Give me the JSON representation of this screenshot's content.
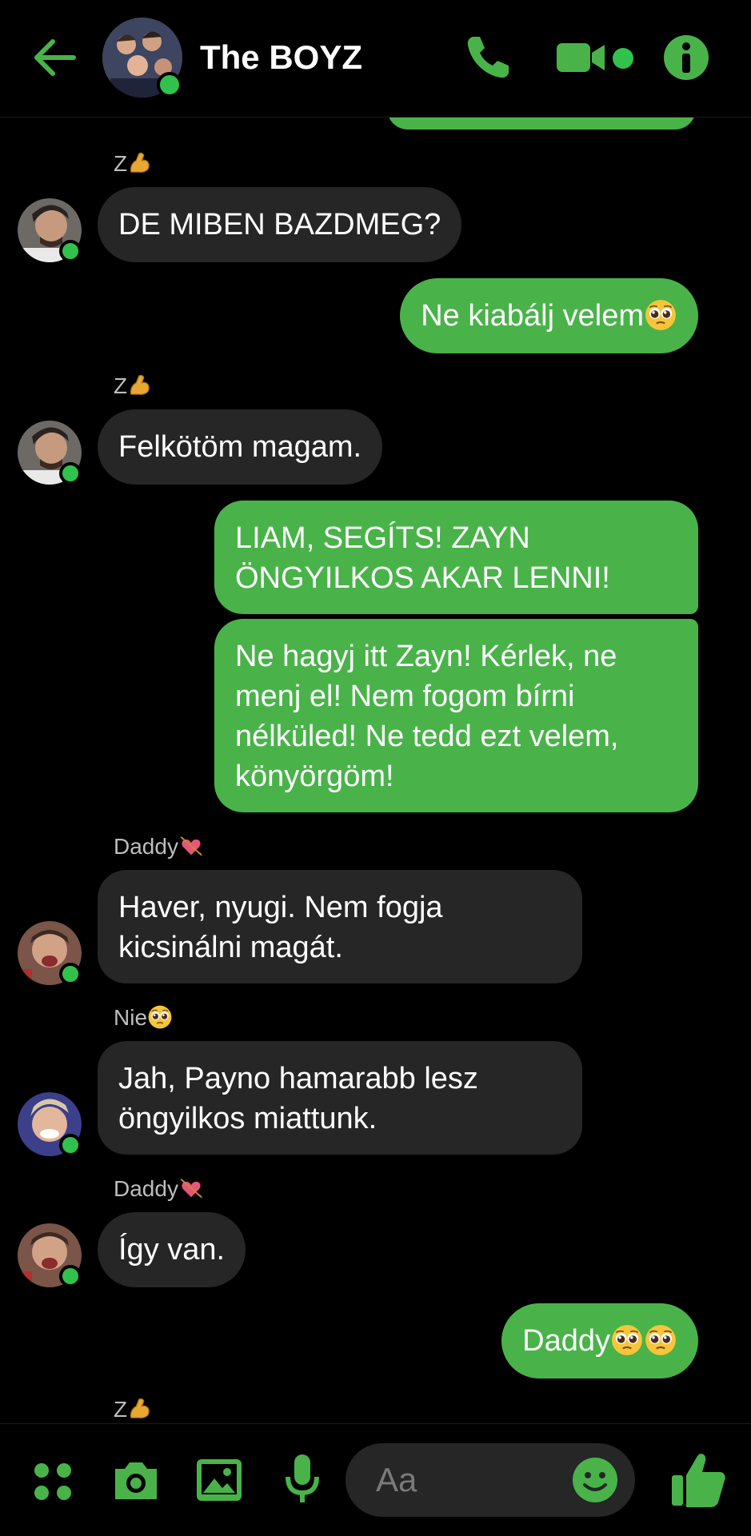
{
  "header": {
    "title": "The BOYZ",
    "accent": "#49b349",
    "online": "#31c24d"
  },
  "messages": [
    {
      "sender": "Z",
      "text": "DE MIBEN BAZDMEG?"
    },
    {
      "sender": "me",
      "text": "Ne kiabálj velem"
    },
    {
      "sender": "Z",
      "text": "Felkötöm magam."
    },
    {
      "sender": "me",
      "lines": [
        "LIAM, SEGÍTS! ZAYN",
        "ÖNGYILKOS AKAR LENNI!"
      ]
    },
    {
      "sender": "me",
      "lines": [
        "Ne hagyj itt Zayn! Kérlek, ne",
        "menj el! Nem fogom bírni",
        "nélküled! Ne tedd ezt velem,",
        "könyörgöm!"
      ]
    },
    {
      "sender": "Daddy",
      "lines": [
        "Haver, nyugi. Nem fogja",
        "kicsinálni magát."
      ]
    },
    {
      "sender": "Nie",
      "lines": [
        "Jah, Payno hamarabb lesz",
        "öngyilkos miattunk."
      ]
    },
    {
      "sender": "Daddy",
      "text": "Így van."
    },
    {
      "sender": "me",
      "text": "Daddy"
    }
  ],
  "names": {
    "z1": "Z",
    "z2": "Z",
    "daddy1": "Daddy",
    "nie": "Nie",
    "daddy2": "Daddy",
    "z3": "Z"
  },
  "composer": {
    "placeholder": "Aa"
  },
  "icons": [
    "back-arrow-icon",
    "phone-icon",
    "video-camera-icon",
    "info-icon",
    "apps-grid-icon",
    "camera-icon",
    "image-icon",
    "microphone-icon",
    "smiley-icon",
    "thumbs-up-icon"
  ]
}
